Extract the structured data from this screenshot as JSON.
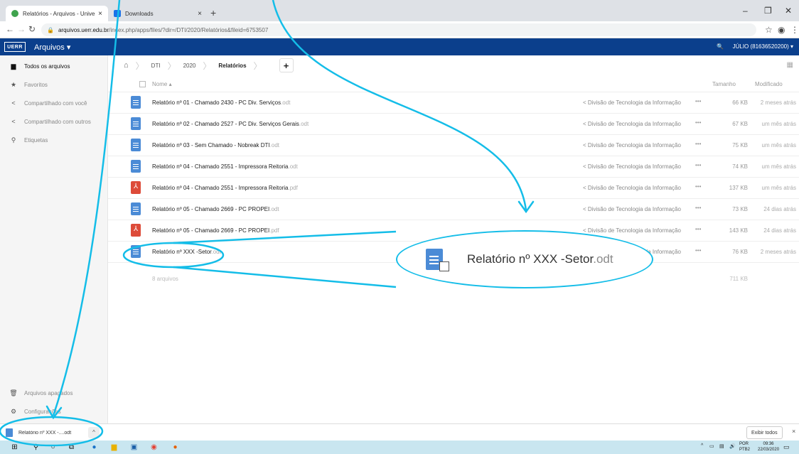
{
  "browser": {
    "tabs": [
      {
        "label": "Relatórios - Arquivos - Universid",
        "close": "×"
      },
      {
        "label": "Downloads",
        "close": "×"
      }
    ],
    "new_tab": "+",
    "url_host": "arquivos.uerr.edu.br",
    "url_path": "/index.php/apps/files/?dir=/DTI/2020/Relatórios&fileid=6753507"
  },
  "header": {
    "logo_text": "UERR",
    "app_name": "Arquivos ▾",
    "user": "JÚLIO (81636520200) ▾"
  },
  "sidebar": {
    "items": [
      {
        "label": "Todos os arquivos",
        "icon": "folder-icon"
      },
      {
        "label": "Favoritos",
        "icon": "star-icon"
      },
      {
        "label": "Compartilhado com você",
        "icon": "share-icon"
      },
      {
        "label": "Compartilhado com outros",
        "icon": "share-icon"
      },
      {
        "label": "Etiquetas",
        "icon": "tag-icon"
      }
    ],
    "trash": "Arquivos apagados",
    "settings": "Configurações"
  },
  "breadcrumb": [
    "DTI",
    "2020",
    "Relatórios"
  ],
  "table": {
    "headers": {
      "name": "Nome ▴",
      "size": "Tamanho",
      "modified": "Modificado"
    },
    "rows": [
      {
        "name": "Relatório nº 01 - Chamado 2430 - PC Div. Serviços",
        "ext": ".odt",
        "type": "odt",
        "share": "Divisão de Tecnologia da Informação",
        "size": "66 KB",
        "modified": "2 meses atrás"
      },
      {
        "name": "Relatório nº 02 - Chamado 2527 - PC Div. Serviços Gerais",
        "ext": ".odt",
        "type": "odt",
        "share": "Divisão de Tecnologia da Informação",
        "size": "67 KB",
        "modified": "um mês atrás"
      },
      {
        "name": "Relatório nº 03 - Sem Chamado - Nobreak DTI",
        "ext": ".odt",
        "type": "odt",
        "share": "Divisão de Tecnologia da Informação",
        "size": "75 KB",
        "modified": "um mês atrás"
      },
      {
        "name": "Relatório nº 04 - Chamado 2551 - Impressora Reitoria",
        "ext": ".odt",
        "type": "odt",
        "share": "Divisão de Tecnologia da Informação",
        "size": "74 KB",
        "modified": "um mês atrás"
      },
      {
        "name": "Relatório nº 04 - Chamado 2551 - Impressora Reitoria",
        "ext": ".pdf",
        "type": "pdf",
        "share": "Divisão de Tecnologia da Informação",
        "size": "137 KB",
        "modified": "um mês atrás"
      },
      {
        "name": "Relatório nº 05 - Chamado 2669 - PC PROPEI",
        "ext": ".odt",
        "type": "odt",
        "share": "Divisão de Tecnologia da Informação",
        "size": "73 KB",
        "modified": "24 dias atrás"
      },
      {
        "name": "Relatório nº 05 - Chamado 2669 - PC PROPEI",
        "ext": ".pdf",
        "type": "pdf",
        "share": "Divisão de Tecnologia da Informação",
        "size": "143 KB",
        "modified": "24 dias atrás"
      },
      {
        "name": "Relatório nº XXX -Setor",
        "ext": ".odt",
        "type": "odt",
        "share": "Divisão de Tecnologia da Informação",
        "size": "76 KB",
        "modified": "2 meses atrás"
      }
    ],
    "summary_count": "8 arquivos",
    "summary_total": "711 KB"
  },
  "zoom": {
    "name": "Relatório nº XXX -Setor",
    "ext": ".odt"
  },
  "downloads": {
    "item": "Relatório nº XXX -....odt",
    "show_all": "Exibir todos",
    "close": "×"
  },
  "taskbar": {
    "lang_line1": "POR",
    "lang_line2": "PTB2",
    "time": "09:36",
    "date": "22/03/2020"
  },
  "colors": {
    "header_bg": "#0b3f8c",
    "annotation": "#14bde8",
    "odt_icon": "#4b8bd6",
    "pdf_icon": "#dd4b39"
  }
}
